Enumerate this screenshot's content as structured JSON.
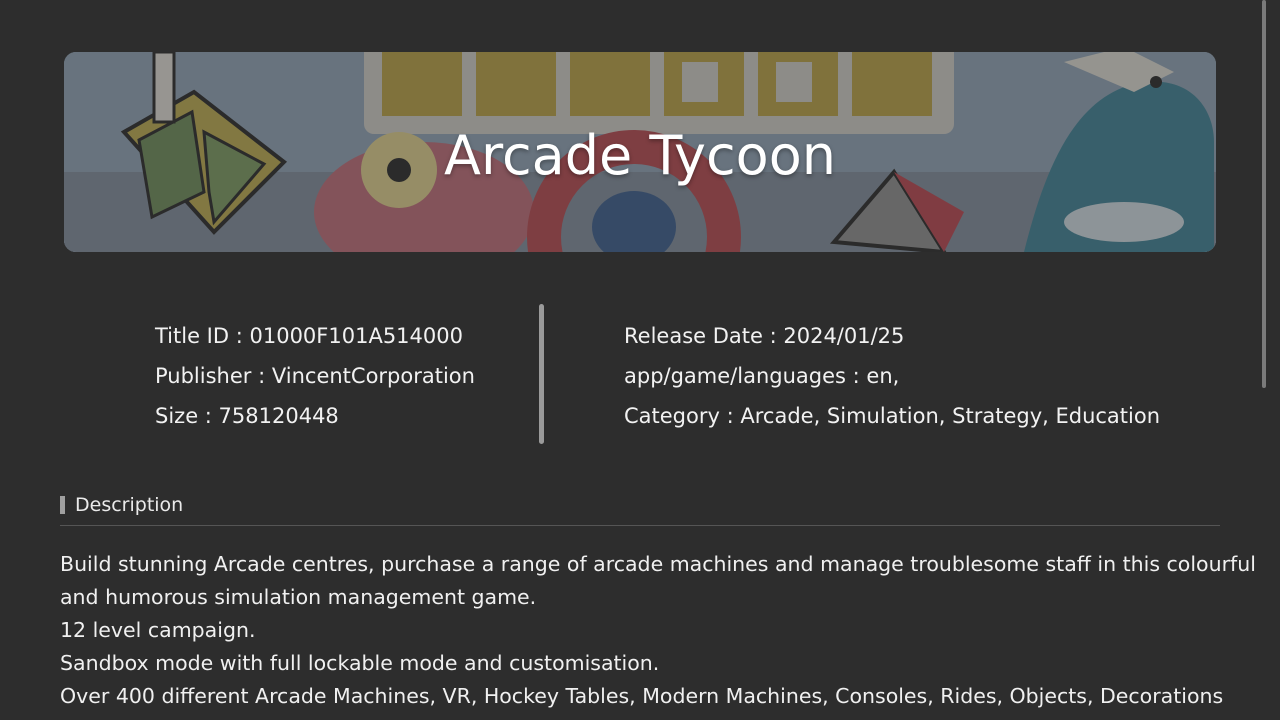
{
  "banner": {
    "title": "Arcade Tycoon"
  },
  "info": {
    "left": [
      {
        "label": "Title ID",
        "value": "01000F101A514000"
      },
      {
        "label": "Publisher",
        "value": "VincentCorporation"
      },
      {
        "label": "Size",
        "value": "758120448"
      }
    ],
    "right": [
      {
        "label": "Release Date",
        "value": "2024/01/25"
      },
      {
        "label": "app/game/languages",
        "value": "en,"
      },
      {
        "label": "Category",
        "value": "Arcade, Simulation, Strategy, Education"
      }
    ]
  },
  "description": {
    "heading": "Description",
    "lines": [
      "Build stunning Arcade centres, purchase a range of arcade machines and manage troublesome staff in this colourful",
      "and humorous simulation management game.",
      "12 level campaign.",
      "Sandbox mode with full lockable mode and customisation.",
      "Over 400 different Arcade Machines, VR, Hockey Tables, Modern Machines, Consoles, Rides, Objects, Decorations"
    ]
  },
  "colors": {
    "background": "#2d2d2d",
    "text": "#ffffff",
    "divider": "#9a9a9a"
  }
}
